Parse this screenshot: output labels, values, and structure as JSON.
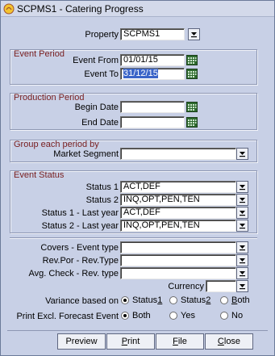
{
  "window": {
    "title": "SCPMS1 - Catering Progress"
  },
  "property": {
    "label": "Property",
    "value": "SCPMS1"
  },
  "event_period": {
    "title": "Event Period",
    "from": {
      "label": "Event From",
      "value": "01/01/15"
    },
    "to": {
      "label": "Event To",
      "value": "31/12/15"
    }
  },
  "production_period": {
    "title": "Production Period",
    "begin": {
      "label": "Begin Date",
      "value": ""
    },
    "end": {
      "label": "End Date",
      "value": ""
    }
  },
  "group_period": {
    "title": "Group each period by",
    "market_segment": {
      "label": "Market Segment",
      "value": ""
    }
  },
  "event_status": {
    "title": "Event Status",
    "status1": {
      "label": "Status 1",
      "value": "ACT,DEF"
    },
    "status2": {
      "label": "Status 2",
      "value": "INQ,OPT,PEN,TEN"
    },
    "status1_last": {
      "label": "Status 1 - Last year",
      "value": "ACT,DEF"
    },
    "status2_last": {
      "label": "Status 2 - Last year",
      "value": "INQ,OPT,PEN,TEN"
    }
  },
  "options": {
    "covers": {
      "label": "Covers - Event type",
      "value": ""
    },
    "revpor": {
      "label": "Rev.Por - Rev.Type",
      "value": ""
    },
    "avgcheck": {
      "label": "Avg. Check - Rev. type",
      "value": ""
    },
    "currency": {
      "label": "Currency",
      "value": ""
    }
  },
  "variance": {
    "label": "Variance based on",
    "options": [
      {
        "pre": "Status ",
        "key": "1",
        "selected": true
      },
      {
        "pre": "Status ",
        "key": "2",
        "selected": false
      },
      {
        "pre": "",
        "key": "B",
        "post": "oth",
        "selected": false
      }
    ]
  },
  "print_excl": {
    "label": "Print Excl. Forecast Event",
    "options": [
      {
        "text": "Both",
        "selected": true
      },
      {
        "text": "Yes",
        "selected": false
      },
      {
        "text": "No",
        "selected": false
      }
    ]
  },
  "buttons": {
    "preview": "Preview",
    "print_pre": "",
    "print_key": "P",
    "print_post": "rint",
    "file_pre": "",
    "file_key": "F",
    "file_post": "ile",
    "close_pre": "",
    "close_key": "C",
    "close_post": "lose"
  },
  "colors": {
    "background": "#c8d0e6",
    "group_title": "#7a1f1f",
    "selection": "#3a64c8"
  }
}
